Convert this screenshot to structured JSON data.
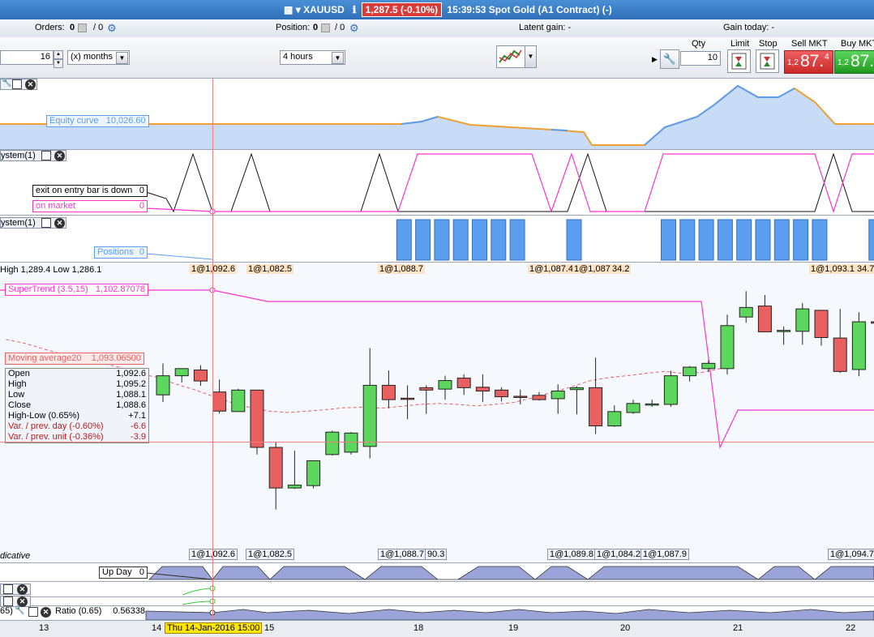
{
  "title_bar": {
    "symbol": "XAUUSD",
    "price_change": "1,287.5 (-0.10%)",
    "time": "15:39:53",
    "instrument": "Spot Gold (A1 Contract) (-)"
  },
  "info_bar": {
    "orders_label": "Orders:",
    "orders_value": "0",
    "orders_slash": "/ 0",
    "position_label": "Position:",
    "position_value": "0",
    "position_slash": "/ 0",
    "latent_gain": "Latent gain: -",
    "gain_today": "Gain today: -"
  },
  "toolbar": {
    "period_value": "16",
    "period_unit": "(x) months",
    "timeframe": "4 hours",
    "qty_label": "Qty",
    "qty_value": "10",
    "limit_label": "Limit",
    "stop_label": "Stop",
    "sell_label": "Sell MKT",
    "sell_small": "1,2",
    "sell_big": "87.",
    "sell_sup": "4",
    "buy_label": "Buy MKT",
    "buy_small": "1,2",
    "buy_big": "87."
  },
  "panels": {
    "equity": {
      "name": "Equity curve",
      "value": "10,026.60"
    },
    "system1": {
      "title": "ystem(1)",
      "exit_label": "exit on entry bar is down",
      "exit_value": "0",
      "market_label": "on market",
      "market_value": "0"
    },
    "system2": {
      "title": "ystem(1)",
      "positions_label": "Positions",
      "positions_value": "0"
    },
    "price": {
      "hl_text": "High 1,289.4 Low 1,286.1",
      "supertrend_label": "SuperTrend (3.5,15)",
      "supertrend_value": "1,102.87078",
      "ma_label": "Moving average20",
      "ma_value": "1,093.06500",
      "tags_top": [
        "1@1,092.6",
        "1@1,082.5",
        "1@1,088.7",
        "1@1,087.4",
        "1@1,087.0",
        "34.2",
        "1@1,093.1",
        "34.7"
      ],
      "tags_bottom": [
        "1@1,092.6",
        "1@1,082.5",
        "1@1,088.7",
        "90.3",
        "1@1,089.8",
        "1@1,084.2",
        "1@1,087.9",
        "1@1,094.7"
      ],
      "indicative": "dicative"
    },
    "info": [
      {
        "k": "Open",
        "v": "1,092.6"
      },
      {
        "k": "High",
        "v": "1,095.2"
      },
      {
        "k": "Low",
        "v": "1,088.1"
      },
      {
        "k": "Close",
        "v": "1,088.6"
      },
      {
        "k": "High-Low (0.65%)",
        "v": "+7.1"
      },
      {
        "k": "Var. / prev. day (-0.60%)",
        "v": "-6.6"
      },
      {
        "k": "Var. / prev. unit (-0.36%)",
        "v": "-3.9"
      }
    ],
    "upday": {
      "label": "Up Day",
      "value": "0"
    },
    "ratio": {
      "prefix": "65)",
      "label": "Ratio (0.65)",
      "value": "0.56338"
    }
  },
  "date_axis": {
    "labels": [
      "13",
      "14",
      "15",
      "18",
      "19",
      "20",
      "21",
      "22"
    ],
    "cursor_label": "Thu 14-Jan-2016 15:00"
  },
  "colors": {
    "bull": "#5cd65c",
    "bear": "#e86060",
    "supertrend": "#ff33cc",
    "equity_line": "#f0a030",
    "equity_fill": "#c9dcf7",
    "position_bar": "#5b9ef0"
  },
  "chart_data": {
    "type": "candlestick",
    "candles": [
      {
        "o": 1092.0,
        "h": 1098.6,
        "l": 1090.5,
        "c": 1096.0
      },
      {
        "o": 1096.0,
        "h": 1097.2,
        "l": 1094.6,
        "c": 1097.5
      },
      {
        "o": 1097.2,
        "h": 1098.2,
        "l": 1093.9,
        "c": 1094.9
      },
      {
        "o": 1092.6,
        "h": 1095.2,
        "l": 1088.1,
        "c": 1088.6
      },
      {
        "o": 1088.5,
        "h": 1093.3,
        "l": 1088.4,
        "c": 1093.0
      },
      {
        "o": 1093.0,
        "h": 1093.0,
        "l": 1079.5,
        "c": 1081.0
      },
      {
        "o": 1081.0,
        "h": 1082.2,
        "l": 1068.0,
        "c": 1072.5
      },
      {
        "o": 1072.5,
        "h": 1080.3,
        "l": 1072.3,
        "c": 1073.1
      },
      {
        "o": 1073.0,
        "h": 1078.3,
        "l": 1072.4,
        "c": 1078.2
      },
      {
        "o": 1079.5,
        "h": 1084.5,
        "l": 1079.3,
        "c": 1084.2
      },
      {
        "o": 1080.0,
        "h": 1084.2,
        "l": 1079.5,
        "c": 1084.0
      },
      {
        "o": 1081.2,
        "h": 1101.8,
        "l": 1078.7,
        "c": 1094.0
      },
      {
        "o": 1094.0,
        "h": 1097.1,
        "l": 1089.2,
        "c": 1091.0
      },
      {
        "o": 1091.3,
        "h": 1094.0,
        "l": 1086.9,
        "c": 1091.1
      },
      {
        "o": 1093.5,
        "h": 1094.0,
        "l": 1088.0,
        "c": 1093.0
      },
      {
        "o": 1093.2,
        "h": 1096.0,
        "l": 1091.0,
        "c": 1095.0
      },
      {
        "o": 1095.5,
        "h": 1096.3,
        "l": 1092.0,
        "c": 1093.5
      },
      {
        "o": 1093.6,
        "h": 1096.3,
        "l": 1090.5,
        "c": 1092.8
      },
      {
        "o": 1093.0,
        "h": 1093.6,
        "l": 1090.6,
        "c": 1091.6
      },
      {
        "o": 1091.7,
        "h": 1093.1,
        "l": 1090.0,
        "c": 1091.6
      },
      {
        "o": 1091.9,
        "h": 1092.6,
        "l": 1090.8,
        "c": 1091.0
      },
      {
        "o": 1091.2,
        "h": 1094.2,
        "l": 1088.0,
        "c": 1092.8
      },
      {
        "o": 1093.1,
        "h": 1093.8,
        "l": 1087.9,
        "c": 1093.5
      },
      {
        "o": 1093.5,
        "h": 1099.8,
        "l": 1083.8,
        "c": 1085.5
      },
      {
        "o": 1085.5,
        "h": 1089.8,
        "l": 1085.3,
        "c": 1088.5
      },
      {
        "o": 1088.3,
        "h": 1091.0,
        "l": 1088.0,
        "c": 1090.2
      },
      {
        "o": 1090.0,
        "h": 1091.0,
        "l": 1089.5,
        "c": 1090.1
      },
      {
        "o": 1090.0,
        "h": 1097.0,
        "l": 1089.5,
        "c": 1096.0
      },
      {
        "o": 1096.0,
        "h": 1098.0,
        "l": 1094.8,
        "c": 1097.8
      },
      {
        "o": 1097.5,
        "h": 1099.2,
        "l": 1096.8,
        "c": 1098.6
      },
      {
        "o": 1097.5,
        "h": 1108.8,
        "l": 1096.3,
        "c": 1106.5
      },
      {
        "o": 1108.3,
        "h": 1113.7,
        "l": 1107.1,
        "c": 1110.3
      },
      {
        "o": 1110.6,
        "h": 1112.9,
        "l": 1105.2,
        "c": 1105.2
      },
      {
        "o": 1105.4,
        "h": 1106.3,
        "l": 1102.5,
        "c": 1105.5
      },
      {
        "o": 1105.3,
        "h": 1111.2,
        "l": 1102.5,
        "c": 1110.0
      },
      {
        "o": 1109.7,
        "h": 1109.6,
        "l": 1102.3,
        "c": 1104.0
      },
      {
        "o": 1103.9,
        "h": 1110.0,
        "l": 1096.6,
        "c": 1096.9
      },
      {
        "o": 1097.3,
        "h": 1109.3,
        "l": 1095.9,
        "c": 1107.3
      },
      {
        "o": 1107.3,
        "h": 1108.0,
        "l": 1103.8,
        "c": 1107.0
      }
    ],
    "ylim": [
      1062,
      1118
    ],
    "supertrend_segments": [
      {
        "from": 0,
        "to": 5,
        "value": 1102.87
      },
      {
        "from": 6,
        "to": 30,
        "value": 1106.9
      },
      {
        "from": 31,
        "to": 38,
        "value": 1084.6
      }
    ],
    "ma_values": [
      1103.6,
      1102.8,
      1101.6,
      1100.5,
      1099.6,
      1098.7,
      1097.8,
      1096.5,
      1095.7,
      1094.3,
      1093.1,
      1091.7,
      1090.4,
      1089.3,
      1088.6,
      1088.3,
      1088.6,
      1088.9,
      1089.3,
      1089.4,
      1089.2,
      1089.6,
      1090.0,
      1090.2,
      1090.0,
      1089.7,
      1090.0,
      1090.4,
      1091.4,
      1092.5,
      1093.6,
      1094.9,
      1095.6,
      1096.0,
      1096.5,
      1096.9,
      1096.5,
      1096.7,
      1097.5
    ],
    "equity": [
      10026.6,
      10026.6,
      10026.6,
      10026.6,
      10026.6,
      10026.6,
      10026.6,
      10026.6,
      10026.6,
      10026.6,
      10026.6,
      10026.6,
      10026.6,
      10026.6,
      10026.6,
      10026.6,
      10026.6,
      10026.6,
      10026.6,
      10026.6,
      10026.6,
      10026.6,
      10026.6,
      10026.6,
      10026.6,
      10026.6,
      10026.6,
      10026.6,
      10026.6,
      10026.6,
      10026.6
    ],
    "positions": [
      0,
      0,
      0,
      0,
      0,
      0,
      0,
      0,
      0,
      0,
      0,
      0,
      0,
      0,
      0,
      0,
      0,
      0,
      0,
      0,
      0,
      1,
      1,
      1,
      1,
      1,
      1,
      1,
      0,
      0,
      1,
      0,
      0,
      0,
      0,
      1,
      1,
      1,
      1,
      1,
      1,
      1,
      1,
      1,
      0,
      0,
      1
    ]
  }
}
